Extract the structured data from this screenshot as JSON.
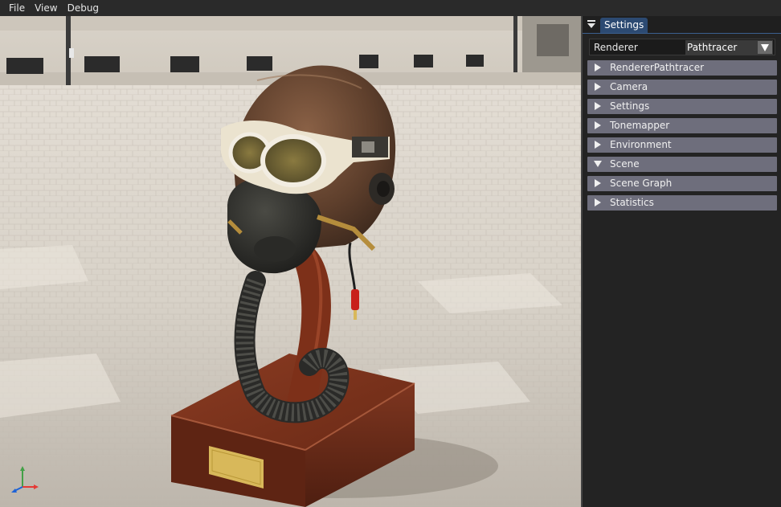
{
  "menubar": {
    "items": [
      {
        "label": "File"
      },
      {
        "label": "View"
      },
      {
        "label": "Debug"
      }
    ]
  },
  "panel": {
    "tab_label": "Settings",
    "collapse_icon": "triangle-down-icon",
    "renderer": {
      "label": "Renderer",
      "value": "Pathtracer",
      "dropdown_icon": "chevron-down-icon"
    },
    "sections": [
      {
        "label": "RendererPathtracer",
        "expanded": false
      },
      {
        "label": "Camera",
        "expanded": false
      },
      {
        "label": "Settings",
        "expanded": false
      },
      {
        "label": "Tonemapper",
        "expanded": false
      },
      {
        "label": "Environment",
        "expanded": false
      },
      {
        "label": "Scene",
        "expanded": true
      },
      {
        "label": "Scene Graph",
        "expanded": false
      },
      {
        "label": "Statistics",
        "expanded": false
      }
    ]
  },
  "colors": {
    "menubar_bg": "#2a2a2a",
    "panel_bg": "#232323",
    "tab_active": "#2c4a72",
    "section_header": "#6e6e7c",
    "axis_x": "#e53935",
    "axis_y": "#43a047",
    "axis_z": "#1e63d6"
  },
  "viewport": {
    "scene": "3d-render-pilot-helmet",
    "gizmo": "xyz-axis-gizmo"
  }
}
